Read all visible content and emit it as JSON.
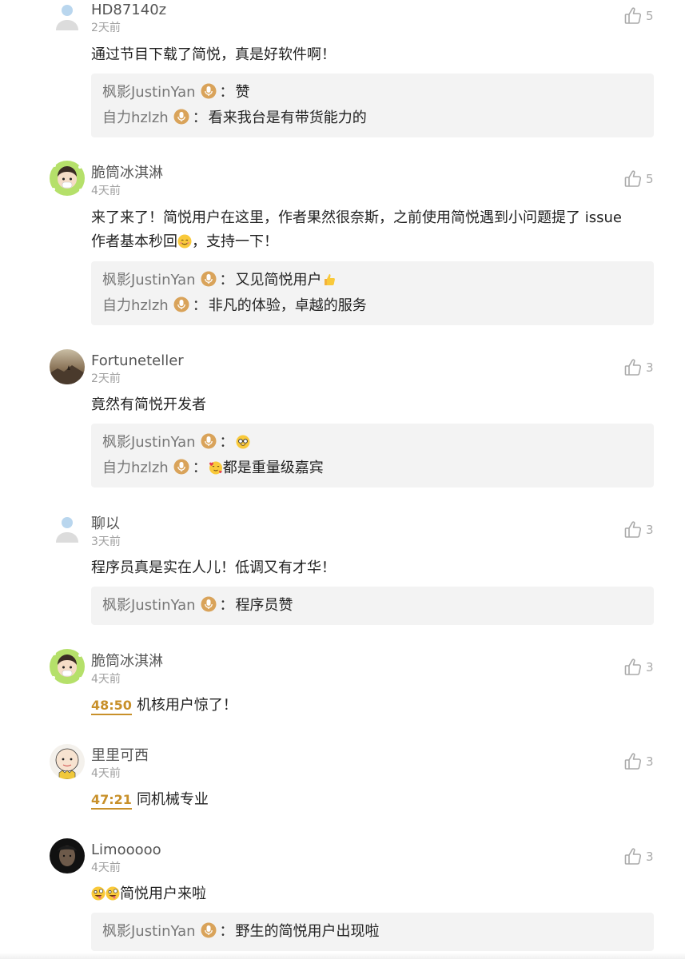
{
  "comments": [
    {
      "username": "HD87140z",
      "time": "2天前",
      "likes": "5",
      "avatar": "default-user",
      "content": "通过节目下载了简悦，真是好软件啊！",
      "replies": [
        {
          "author": "枫影JustinYan",
          "separator": "：",
          "text": "赞"
        },
        {
          "author": "自力hzlzh",
          "separator": "：",
          "text": "看来我台是有带货能力的"
        }
      ]
    },
    {
      "username": "脆筒冰淇淋",
      "time": "4天前",
      "likes": "5",
      "avatar": "cartoon-boy",
      "content_line1": "来了来了！简悦用户在这里，作者果然很奈斯，之前使用简悦遇到小问题提了 issue",
      "content_line2": "作者基本秒回",
      "content_line2_end": "，支持一下！",
      "replies": [
        {
          "author": "枫影JustinYan",
          "separator": "：",
          "text": "又见简悦用户"
        },
        {
          "author": "自力hzlzh",
          "separator": "：",
          "text": "非凡的体验，卓越的服务"
        }
      ]
    },
    {
      "username": "Fortuneteller",
      "time": "2天前",
      "likes": "3",
      "avatar": "photo-landscape",
      "content": "竟然有简悦开发者",
      "replies": [
        {
          "author": "枫影JustinYan",
          "separator": "：",
          "text": ""
        },
        {
          "author": "自力hzlzh",
          "separator": "：",
          "text": "都是重量级嘉宾"
        }
      ]
    },
    {
      "username": "聊以",
      "time": "3天前",
      "likes": "3",
      "avatar": "default-user",
      "content": "程序员真是实在人儿！低调又有才华！",
      "replies": [
        {
          "author": "枫影JustinYan",
          "separator": "：",
          "text": "程序员赞"
        }
      ]
    },
    {
      "username": "脆筒冰淇淋",
      "time": "4天前",
      "likes": "3",
      "avatar": "cartoon-boy",
      "timestamp": "48:50",
      "content": "机核用户惊了！"
    },
    {
      "username": "里里可西",
      "time": "4天前",
      "likes": "3",
      "avatar": "cartoon-charlie",
      "timestamp": "47:21",
      "content": "同机械专业"
    },
    {
      "username": "Limooooo",
      "time": "4天前",
      "likes": "3",
      "avatar": "photo-portrait",
      "content": "简悦用户来啦",
      "replies": [
        {
          "author": "枫影JustinYan",
          "separator": "：",
          "text": "野生的简悦用户出现啦"
        }
      ]
    }
  ],
  "colors": {
    "accent": "#c8902a",
    "reply_bg": "#f3f3f3",
    "muted": "#a0a0a0"
  }
}
